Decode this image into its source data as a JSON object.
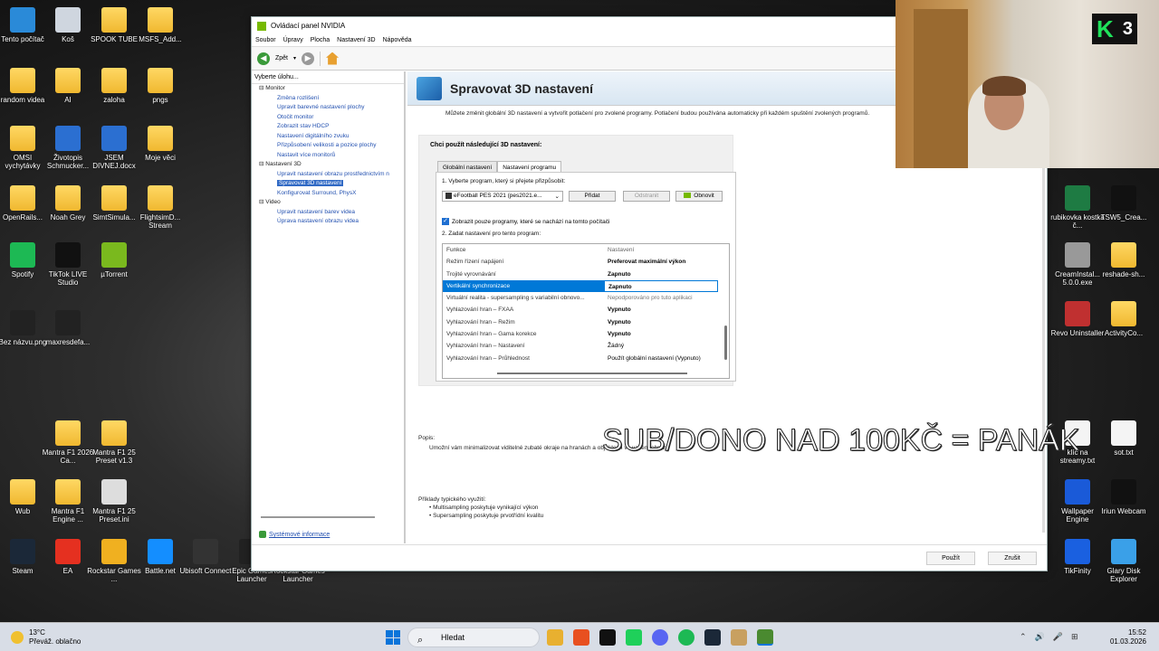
{
  "desktop": {
    "icons_left": [
      {
        "label": "Tento počítač",
        "icon": "computer-icon"
      },
      {
        "label": "Koš",
        "icon": "recycle-bin-icon"
      },
      {
        "label": "SPOOK TUBE",
        "icon": "folder-icon"
      },
      {
        "label": "MSFS_Add...",
        "icon": "folder-icon"
      },
      {
        "label": "random videa",
        "icon": "folder-icon"
      },
      {
        "label": "AI",
        "icon": "folder-icon"
      },
      {
        "label": "zaloha",
        "icon": "folder-icon"
      },
      {
        "label": "pngs",
        "icon": "folder-icon"
      },
      {
        "label": "OMSI vychytávky",
        "icon": "folder-icon"
      },
      {
        "label": "Životopis Schmucker...",
        "icon": "word-doc-icon"
      },
      {
        "label": "JSEM DIVNEJ.docx",
        "icon": "word-doc-icon"
      },
      {
        "label": "Moje věci",
        "icon": "folder-icon"
      },
      {
        "label": "OpenRails...",
        "icon": "folder-icon"
      },
      {
        "label": "Noah Grey",
        "icon": "folder-icon"
      },
      {
        "label": "SimtSimula...",
        "icon": "folder-icon"
      },
      {
        "label": "FlightsimD... Stream",
        "icon": "folder-icon"
      },
      {
        "label": "Spotify",
        "icon": "spotify-icon"
      },
      {
        "label": "TikTok LIVE Studio",
        "icon": "tiktok-icon"
      },
      {
        "label": "µTorrent",
        "icon": "utorrent-icon"
      },
      {
        "label": "Bez názvu.png",
        "icon": "image-icon"
      },
      {
        "label": "maxresdefa...",
        "icon": "image-icon"
      },
      {
        "label": "Mantra F1 2026 Ca...",
        "icon": "folder-icon"
      },
      {
        "label": "Mantra F1 25 Preset v1.3",
        "icon": "folder-icon"
      },
      {
        "label": "Wub",
        "icon": "folder-icon"
      },
      {
        "label": "Mantra F1 Engine ...",
        "icon": "folder-icon"
      },
      {
        "label": "Mantra F1 25 Preset.ini",
        "icon": "settings-file-icon"
      },
      {
        "label": "Steam",
        "icon": "steam-icon"
      },
      {
        "label": "EA",
        "icon": "ea-icon"
      },
      {
        "label": "Rockstar Games ...",
        "icon": "rockstar-icon"
      },
      {
        "label": "Battle.net",
        "icon": "battlenet-icon"
      },
      {
        "label": "Ubisoft Connect",
        "icon": "ubisoft-icon"
      },
      {
        "label": "Epic Games Launcher",
        "icon": "epic-icon"
      },
      {
        "label": "Rockstar Games Launcher",
        "icon": "rockstar-icon"
      }
    ],
    "icons_right": [
      {
        "label": "rubikovka kostka č...",
        "icon": "excel-icon"
      },
      {
        "label": "TSW5_Crea...",
        "icon": "7zip-icon"
      },
      {
        "label": "CreamInstal... 5.0.0.exe",
        "icon": "gear-icon"
      },
      {
        "label": "reshade-sh...",
        "icon": "folder-icon"
      },
      {
        "label": "Revo Uninstaller",
        "icon": "revo-icon"
      },
      {
        "label": "ActivityCo...",
        "icon": "folder-icon"
      },
      {
        "label": "klíč na streamy.txt",
        "icon": "text-file-icon"
      },
      {
        "label": "sot.txt",
        "icon": "text-file-icon"
      },
      {
        "label": "Wallpaper Engine",
        "icon": "wallpaper-engine-icon"
      },
      {
        "label": "Iriun Webcam",
        "icon": "webcam-icon"
      },
      {
        "label": "TikFinity",
        "icon": "tikfinity-icon"
      },
      {
        "label": "Glary Disk Explorer",
        "icon": "disk-explorer-icon"
      }
    ]
  },
  "window": {
    "title": "Ovládací panel NVIDIA",
    "menu": [
      "Soubor",
      "Úpravy",
      "Plocha",
      "Nastavení 3D",
      "Nápověda"
    ],
    "toolbar": {
      "back_label": "Zpět"
    },
    "sidebar": {
      "header": "Vyberte úlohu...",
      "sections": [
        {
          "label": "Monitor",
          "items": [
            "Změna rozlišení",
            "Upravit barevné nastavení plochy",
            "Otočit monitor",
            "Zobrazit stav HDCP",
            "Nastavení digitálního zvuku",
            "Přizpůsobení velikosti a pozice plochy",
            "Nastavit více monitorů"
          ]
        },
        {
          "label": "Nastavení 3D",
          "items": [
            "Upravit nastavení obrazu prostřednictvím n",
            "Spravovat 3D nastavení",
            "Konfigurovat Surround, PhysX"
          ]
        },
        {
          "label": "Video",
          "items": [
            "Upravit nastavení barev videa",
            "Úprava nastavení obrazu videa"
          ]
        }
      ],
      "selected": "Spravovat 3D nastavení",
      "system_info": "Systémové informace"
    },
    "content": {
      "heading": "Spravovat 3D nastavení",
      "intro": "Můžete změnit globální 3D nastavení a vytvořit potlačení pro zvolené programy. Potlačení budou používána automaticky při každém spuštění zvolených programů.",
      "panel_title": "Chci použít následující 3D nastavení:",
      "tabs": [
        "Globální nastavení",
        "Nastavení programu"
      ],
      "active_tab": "Nastavení programu",
      "step1": "1. Vyberte program, který si přejete přizpůsobit:",
      "program": "eFootball PES 2021 (pes2021.e...",
      "btn_add": "Přidat",
      "btn_remove": "Odstranit",
      "btn_restore": "Obnovit",
      "checkbox": "Zobrazit pouze programy, které se nachází na tomto počítači",
      "step2": "2. Zadat nastavení pro tento program:",
      "grid_headers": [
        "Funkce",
        "Nastavení"
      ],
      "grid_rows": [
        {
          "feature": "Režim řízení napájení",
          "value": "Preferovat maximální výkon",
          "style": "b"
        },
        {
          "feature": "Trojité vyrovnávání",
          "value": "Zapnuto",
          "style": "b"
        },
        {
          "feature": "Vertikální synchronizace",
          "value": "Zapnuto",
          "style": "sel"
        },
        {
          "feature": "Virtuální realita - supersampling s variabilní obnovo...",
          "value": "Nepodporováno pro tuto aplikaci",
          "style": "g"
        },
        {
          "feature": "Vyhlazování hran – FXAA",
          "value": "Vypnuto",
          "style": "b"
        },
        {
          "feature": "Vyhlazování hran – Režim",
          "value": "Vypnuto",
          "style": "b"
        },
        {
          "feature": "Vyhlazování hran – Gama korekce",
          "value": "Vypnuto",
          "style": "b"
        },
        {
          "feature": "Vyhlazování hran – Nastavení",
          "value": "Žádný",
          "style": ""
        },
        {
          "feature": "Vyhlazování hran – Průhlednost",
          "value": "Použít globální nastavení (Vypnuto)",
          "style": ""
        }
      ],
      "desc_label": "Popis:",
      "desc_text": "Umožní vám minimalizovat viditelné zubaté okraje na hranách a objektech ve vašem obrazu",
      "usage_label": "Příklady typického využití:",
      "usage_items": [
        "Multisampling poskytuje vynikající výkon",
        "Supersampling poskytuje prvotřídní kvalitu"
      ]
    },
    "footer": {
      "apply": "Použít",
      "cancel": "Zrušit"
    }
  },
  "overlay_text": "SUB/DONO NAD 100KČ = PANÁK",
  "webcam": {
    "badge_letter": "K",
    "badge_number": "3"
  },
  "taskbar": {
    "weather_temp": "13°C",
    "weather_desc": "Převáž. oblačno",
    "search_placeholder": "Hledat",
    "time": "15:52",
    "date": "01.03.2026"
  }
}
